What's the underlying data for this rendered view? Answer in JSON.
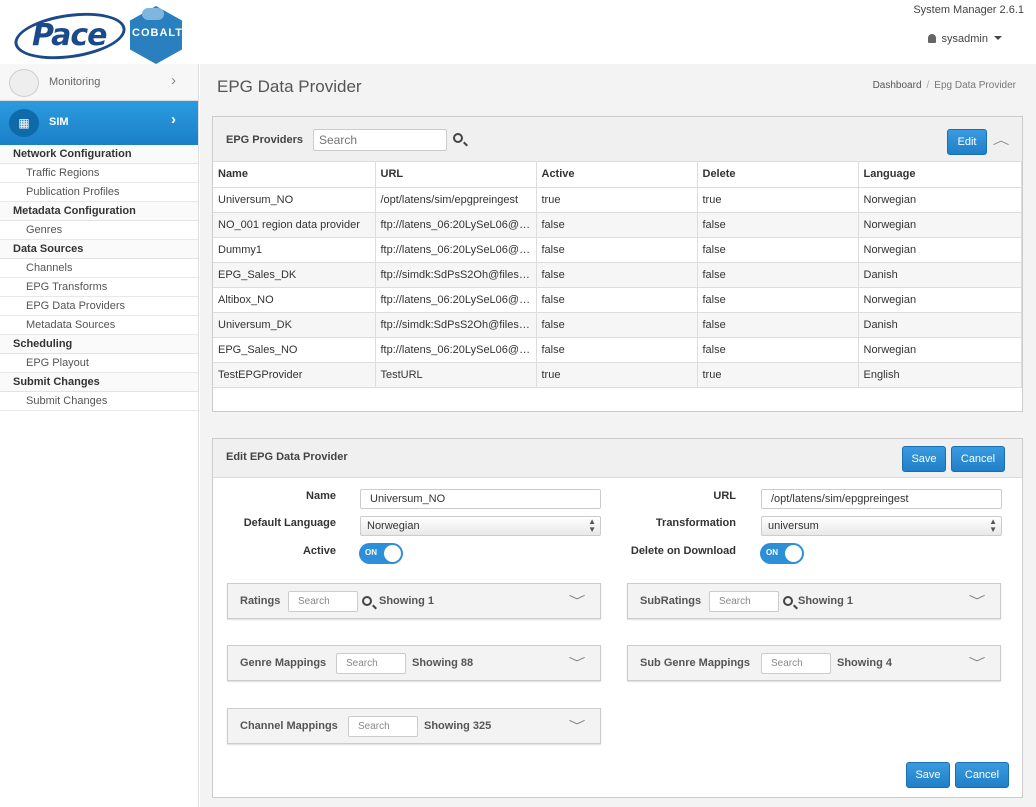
{
  "header": {
    "brand": "Pace",
    "product": "COBALT",
    "system_version": "System Manager 2.6.1",
    "user": "sysadmin"
  },
  "sidebar": {
    "monitoring_label": "Monitoring",
    "sim_label": "SIM",
    "sections": [
      {
        "title": "Network Configuration",
        "items": [
          "Traffic Regions",
          "Publication Profiles"
        ]
      },
      {
        "title": "Metadata Configuration",
        "items": [
          "Genres"
        ]
      },
      {
        "title": "Data Sources",
        "items": [
          "Channels",
          "EPG Transforms",
          "EPG Data Providers",
          "Metadata Sources"
        ]
      },
      {
        "title": "Scheduling",
        "items": [
          "EPG Playout"
        ]
      },
      {
        "title": "Submit Changes",
        "items": [
          "Submit Changes"
        ]
      }
    ]
  },
  "page": {
    "title": "EPG Data Provider",
    "breadcrumb": [
      "Dashboard",
      "Epg Data Provider"
    ]
  },
  "providers": {
    "title": "EPG Providers",
    "search_placeholder": "Search",
    "edit_label": "Edit",
    "columns": [
      "Name",
      "URL",
      "Active",
      "Delete",
      "Language"
    ],
    "rows": [
      [
        "Universum_NO",
        "/opt/latens/sim/epgpreingest",
        "true",
        "true",
        "Norwegian"
      ],
      [
        "NO_001 region data provider",
        "ftp://latens_06:20LySeL06@fil...",
        "false",
        "false",
        "Norwegian"
      ],
      [
        "Dummy1",
        "ftp://latens_06:20LySeL06@fil...",
        "false",
        "false",
        "Norwegian"
      ],
      [
        "EPG_Sales_DK",
        "ftp://simdk:SdPsS2Oh@filesh...",
        "false",
        "false",
        "Danish"
      ],
      [
        "Altibox_NO",
        "ftp://latens_06:20LySeL06@fil...",
        "false",
        "false",
        "Norwegian"
      ],
      [
        "Universum_DK",
        "ftp://simdk:SdPsS2Oh@filesh...",
        "false",
        "false",
        "Danish"
      ],
      [
        "EPG_Sales_NO",
        "ftp://latens_06:20LySeL06@fil...",
        "false",
        "false",
        "Norwegian"
      ],
      [
        "TestEPGProvider",
        "TestURL",
        "true",
        "true",
        "English"
      ]
    ]
  },
  "edit": {
    "title": "Edit EPG Data Provider",
    "save_label": "Save",
    "cancel_label": "Cancel",
    "name_label": "Name",
    "name_value": "Universum_NO",
    "url_label": "URL",
    "url_value": "/opt/latens/sim/epgpreingest",
    "lang_label": "Default Language",
    "lang_value": "Norwegian",
    "transform_label": "Transformation",
    "transform_value": "universum",
    "active_label": "Active",
    "active_toggle": "ON",
    "delete_label": "Delete on Download",
    "delete_toggle": "ON",
    "ratings": {
      "title": "Ratings",
      "search": "Search",
      "showing": "Showing 1"
    },
    "subratings": {
      "title": "SubRatings",
      "search": "Search",
      "showing": "Showing 1"
    },
    "genre": {
      "title": "Genre Mappings",
      "search": "Search",
      "showing": "Showing 88"
    },
    "subgenre": {
      "title": "Sub Genre Mappings",
      "search": "Search",
      "showing": "Showing 4"
    },
    "channel": {
      "title": "Channel Mappings",
      "search": "Search",
      "showing": "Showing 325"
    }
  }
}
